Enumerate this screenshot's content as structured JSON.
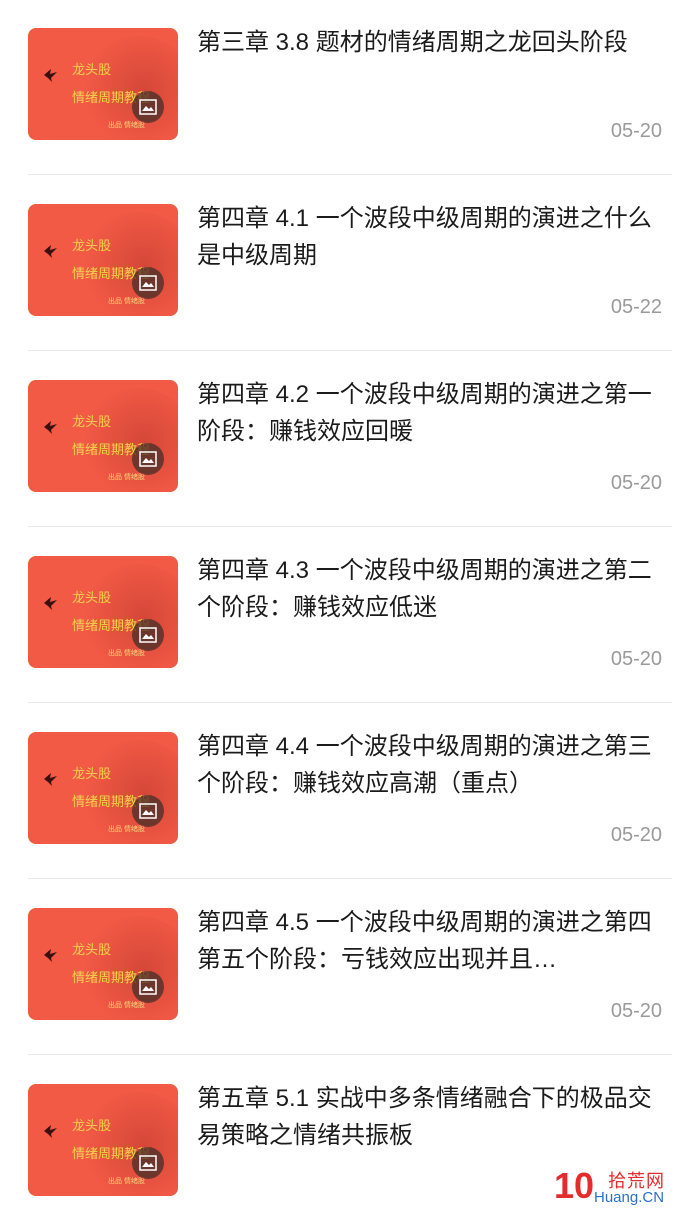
{
  "thumbnail": {
    "brand": "龙头股",
    "subtitle": "情绪周期教程",
    "tiny_text": "出品 情绪股"
  },
  "items": [
    {
      "title": "第三章 3.8 题材的情绪周期之龙回头阶段",
      "date": "05-20"
    },
    {
      "title": "第四章 4.1 一个波段中级周期的演进之什么是中级周期",
      "date": "05-22"
    },
    {
      "title": "第四章 4.2 一个波段中级周期的演进之第一阶段：赚钱效应回暖",
      "date": "05-20"
    },
    {
      "title": "第四章 4.3 一个波段中级周期的演进之第二个阶段：赚钱效应低迷",
      "date": "05-20"
    },
    {
      "title": "第四章 4.4 一个波段中级周期的演进之第三个阶段：赚钱效应高潮（重点）",
      "date": "05-20"
    },
    {
      "title": "第四章 4.5 一个波段中级周期的演进之第四第五个阶段：亏钱效应出现并且…",
      "date": "05-20"
    },
    {
      "title": "第五章 5.1 实战中多条情绪融合下的极品交易策略之情绪共振板",
      "date": ""
    }
  ],
  "watermark": {
    "number": "10",
    "chinese": "拾荒网",
    "domain": "Huang.CN"
  },
  "colors": {
    "thumb_bg": "#f25a45",
    "thumb_text": "#f3d34a",
    "date": "#9a9a9a",
    "divider": "#e8e8e8"
  }
}
